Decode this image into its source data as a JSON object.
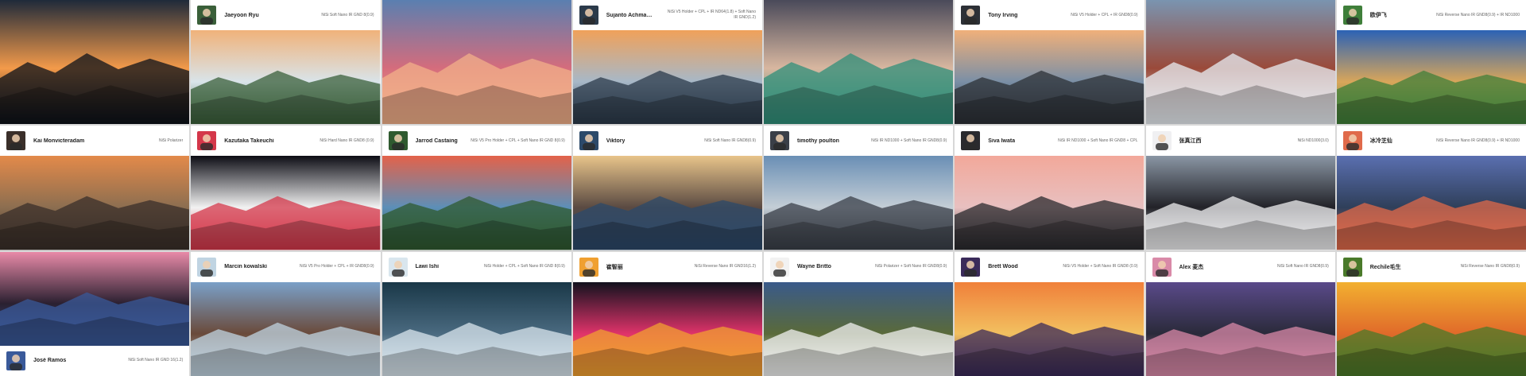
{
  "colors": {
    "caption_bg": "#ffffff",
    "name_text": "#222222",
    "gear_text": "#666666"
  },
  "cells": [
    {
      "photographer": "",
      "gear": "",
      "caption_position": "none",
      "scene": "night town in valley mist",
      "palette": [
        "#1f2a3a",
        "#0c1119",
        "#f39a4a"
      ]
    },
    {
      "photographer": "Jaeyoon Ryu",
      "gear": "NiSi Soft Nano IR GND 8(0.9)",
      "caption_position": "top",
      "scene": "sunrise over misty peaks",
      "palette": [
        "#f0b27a",
        "#3a5f39",
        "#d9e4ea"
      ]
    },
    {
      "photographer": "",
      "gear": "",
      "caption_position": "none",
      "scene": "lone tree in lake at sunrise",
      "palette": [
        "#5a7fb0",
        "#f2b08a",
        "#d56c7c"
      ]
    },
    {
      "photographer": "Sujanto Achmadi Jaya",
      "gear": "NiSi V5 Holder + CPL + IR ND64(1.8) + Soft Nano IR GND(1.2)",
      "caption_position": "top",
      "scene": "wooden pier over calm sea",
      "palette": [
        "#f0a15a",
        "#2b3a4a",
        "#a7b8c8"
      ]
    },
    {
      "photographer": "",
      "gear": "",
      "caption_position": "none",
      "scene": "mountain towers over turquoise lake",
      "palette": [
        "#4a4a5a",
        "#2f8f7a",
        "#d8b7a0"
      ]
    },
    {
      "photographer": "Tony Irving",
      "gear": "NiSi V5 Holder + CPL + IR GND8(0.9)",
      "caption_position": "top",
      "scene": "coastal cliffs at dusk",
      "palette": [
        "#f0b07a",
        "#2c3036",
        "#7a8fa6"
      ]
    },
    {
      "photographer": "",
      "gear": "",
      "caption_position": "none",
      "scene": "white palace in snow",
      "palette": [
        "#7a94b0",
        "#e8eef3",
        "#9a4a3a"
      ]
    },
    {
      "photographer": "欧伊飞",
      "gear": "NiSi Reverse Nano IR GND8(0.9) + IR ND1000",
      "caption_position": "top",
      "scene": "great wall over green hills",
      "palette": [
        "#2b62b5",
        "#3f7f3a",
        "#d9a65a"
      ]
    },
    {
      "photographer": "Kai Monvicteradam",
      "gear": "NiSi Polarizer",
      "caption_position": "top",
      "scene": "dramatic sky over mountain river",
      "palette": [
        "#e38a4a",
        "#3a2f2a",
        "#8c6e50"
      ]
    },
    {
      "photographer": "Kazutaka Takeuchi",
      "gear": "NiSi Hard Nano IR GND8 (0.9)",
      "caption_position": "top",
      "scene": "fireworks",
      "palette": [
        "#0c0c14",
        "#d4374a",
        "#f2f2f2"
      ]
    },
    {
      "photographer": "Jarrod Castaing",
      "gear": "NiSi V5 Pro Holder + CPL + Soft Nano IR GND 8(0.9)",
      "caption_position": "top",
      "scene": "aerial lake and forest at sunset",
      "palette": [
        "#e3624a",
        "#2f5a2f",
        "#5c8fb8"
      ]
    },
    {
      "photographer": "Viktory",
      "gear": "NiSi Soft Nano IR GND8(0.9)",
      "caption_position": "top",
      "scene": "sea stacks at twilight",
      "palette": [
        "#e8c48a",
        "#2c4a6a",
        "#5a4a42"
      ]
    },
    {
      "photographer": "timothy poulton",
      "gear": "NiSi IR ND1000 + Soft Nano IR GND8(0.9)",
      "caption_position": "top",
      "scene": "castle on hill with rocky shore",
      "palette": [
        "#6a8fb5",
        "#3a3f48",
        "#c4ced6"
      ]
    },
    {
      "photographer": "Siva Iwata",
      "gear": "NiSi IR ND1000 + Soft Nano IR GND8 + CPL",
      "caption_position": "top",
      "scene": "rocks in pink sea",
      "palette": [
        "#f2a89a",
        "#2a2a2e",
        "#e8c0c0"
      ]
    },
    {
      "photographer": "张真江西",
      "gear": "NiSi ND1000(3.0)",
      "caption_position": "top",
      "scene": "rocks in misty sea",
      "palette": [
        "#8a96a4",
        "#f0f0f2",
        "#222228"
      ]
    },
    {
      "photographer": "冰冷芝仙",
      "gear": "NiSi Reverse Nano IR GND8(0.9) + IR ND1000",
      "caption_position": "top",
      "scene": "lakeside village at sunset",
      "palette": [
        "#5a6fb0",
        "#e06a4a",
        "#2f3f5a"
      ]
    },
    {
      "photographer": "José Ramos",
      "gear": "NiSi Soft Nano IR GND 16(1.2)",
      "caption_position": "bottom",
      "scene": "pier at pink dusk lake",
      "palette": [
        "#e88aa8",
        "#3a5a9a",
        "#2a2030"
      ]
    },
    {
      "photographer": "Marcin kowalski",
      "gear": "NiSi V5 Pro Holder + CPL + IR GND8(0.9)",
      "caption_position": "top",
      "scene": "lighthouse on rocky coast",
      "palette": [
        "#7aa0c8",
        "#c0d4e2",
        "#6a4a3a"
      ]
    },
    {
      "photographer": "Lawi Ishi",
      "gear": "NiSi Holder + CPL + Soft Nano IR GND 8(0.9)",
      "caption_position": "top",
      "scene": "waterfall in snow",
      "palette": [
        "#1a3848",
        "#d9e6ee",
        "#4a6a80"
      ]
    },
    {
      "photographer": "崔智丽",
      "gear": "NiSi Reverse Nano IR GND16(1.2)",
      "caption_position": "top",
      "scene": "fireworks over city",
      "palette": [
        "#12121e",
        "#f0a030",
        "#e0336a"
      ]
    },
    {
      "photographer": "Wayne Britto",
      "gear": "NiSi Polarizer + Soft Nano IR GND8(0.9)",
      "caption_position": "top",
      "scene": "clouds flowing past mountain",
      "palette": [
        "#3a5a8a",
        "#f2f2f2",
        "#5a6a3a"
      ]
    },
    {
      "photographer": "Brett Wood",
      "gear": "NiSi V5 Holder + Soft Nano IR GND8 (0.9)",
      "caption_position": "top",
      "scene": "boats at golden sunset harbor",
      "palette": [
        "#f0803a",
        "#3a2a5a",
        "#f2c060"
      ]
    },
    {
      "photographer": "Alex 麦杰",
      "gear": "NiSi Soft Nano IR GND8(0.9)",
      "caption_position": "top",
      "scene": "purple storm clouds over beach",
      "palette": [
        "#5a4a8a",
        "#d98aa8",
        "#2a2a3a"
      ]
    },
    {
      "photographer": "Rechile毛生",
      "gear": "NiSi Reverse Nano IR GND8(0.9)",
      "caption_position": "top",
      "scene": "golden sunset over grassland",
      "palette": [
        "#f2b030",
        "#4a7a2a",
        "#e06a2a"
      ]
    }
  ]
}
